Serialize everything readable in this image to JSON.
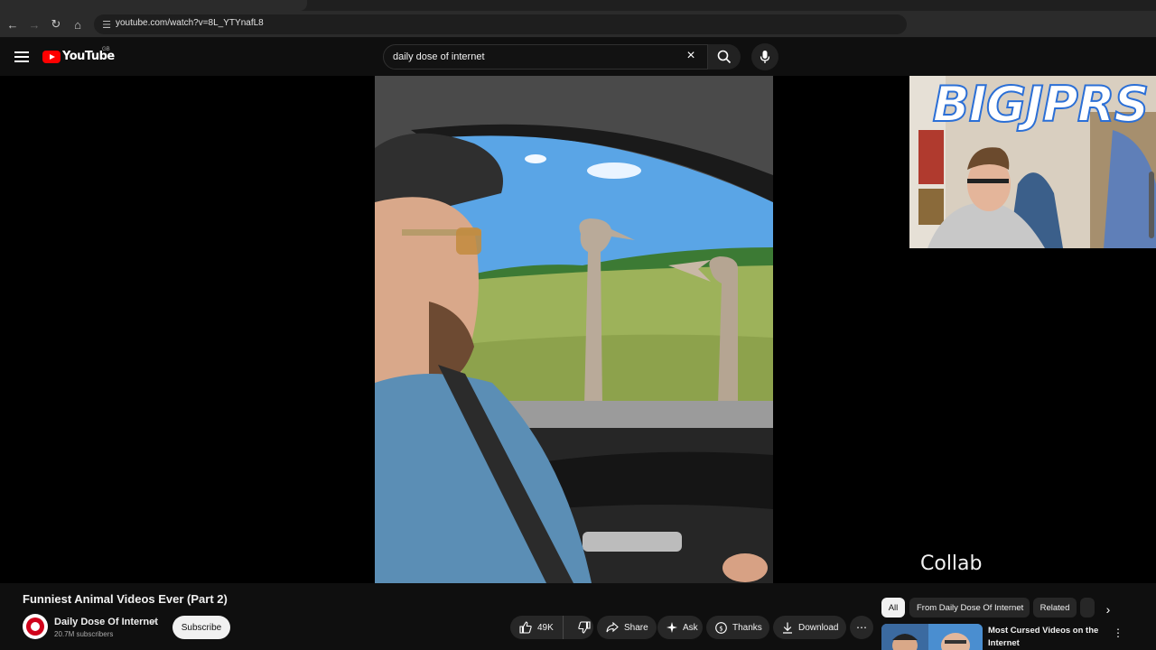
{
  "browser": {
    "url": "youtube.com/watch?v=8L_YTYnafL8",
    "nav_icons": [
      "back-icon",
      "forward-icon",
      "reload-icon",
      "home-icon"
    ]
  },
  "masthead": {
    "logo_text": "YouTube",
    "country_code": "GB",
    "search_query": "daily dose of internet",
    "brand_color": "#ff0000"
  },
  "player": {
    "overlay_caption": "Collab",
    "webcam_overlay_text": "BIGJPRS"
  },
  "video": {
    "title": "Funniest Animal Videos Ever (Part 2)",
    "channel_name": "Daily Dose Of Internet",
    "subscribers": "20.7M subscribers",
    "subscribe_label": "Subscribe",
    "like_count": "49K",
    "actions": {
      "share": "Share",
      "ask": "Ask",
      "thanks": "Thanks",
      "download": "Download"
    }
  },
  "related": {
    "chips": [
      "All",
      "From Daily Dose Of Internet",
      "Related"
    ],
    "active_chip": "All",
    "first_title": "Most Cursed Videos on the Internet"
  }
}
